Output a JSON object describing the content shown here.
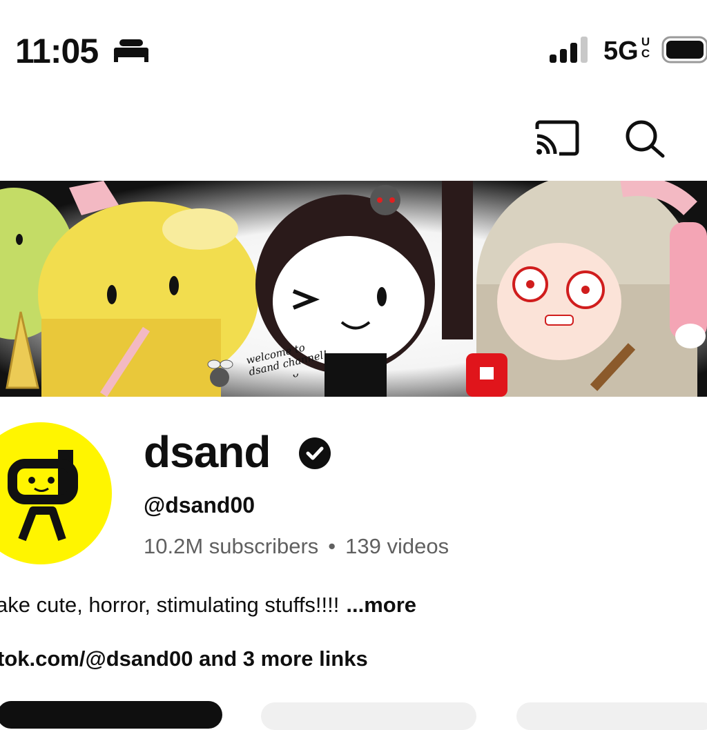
{
  "status_bar": {
    "time": "11:05",
    "sleep_focus_icon": "bed-icon",
    "network": "5G",
    "network_superscript": "UC",
    "signal_icon": "cellular-signal-icon",
    "battery_icon": "battery-icon"
  },
  "header": {
    "cast_icon": "cast-icon",
    "search_icon": "search-icon"
  },
  "banner": {
    "text_line1": "welcome to",
    "text_line2": "dsand channel!",
    "text_line3": "ᴗ"
  },
  "channel": {
    "name": "dsand",
    "verified_icon": "verified-check-icon",
    "handle": "@dsand00",
    "subscribers": "10.2M subscribers",
    "separator": "•",
    "videos": "139 videos",
    "description": "ake cute, horror, stimulating stuffs!!!!",
    "more_label": "...more",
    "links_url": "tok.com/@dsand00",
    "links_more": " and 3 more links"
  },
  "colors": {
    "avatar_bg": "#fff500",
    "text_primary": "#0f0f0f",
    "text_secondary": "#606060"
  }
}
